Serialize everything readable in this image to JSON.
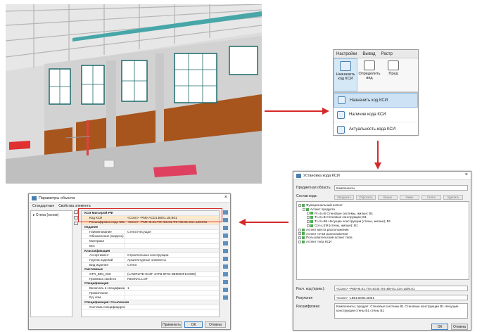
{
  "ribbon": {
    "tabs": [
      "Настройки",
      "Вывод",
      "Растр"
    ],
    "buttons": [
      {
        "label": "Назначить код КСИ",
        "icon": "ksi-assign-icon"
      },
      {
        "label": "Определить вид",
        "icon": "define-view-icon"
      },
      {
        "label": "Пред",
        "icon": "partial-icon"
      }
    ],
    "menu": [
      {
        "label": "Назначить код КСИ",
        "icon_text": "КСИ"
      },
      {
        "label": "Наличие кода КСИ",
        "icon_text": "КСИ"
      },
      {
        "label": "Актуальность кода КСИ",
        "icon_text": "КСИ"
      }
    ]
  },
  "assign_dialog": {
    "title": "Установка кода КСИ",
    "domain_label": "Предметная область:",
    "domain_value": "Компоненты",
    "code_label": "Состав кода:",
    "toolbar": [
      "Загрузить",
      "Сбросить",
      "Выше",
      "Ниже",
      "Снять",
      "Удалить"
    ],
    "tree": [
      {
        "level": 0,
        "text": "Функциональный аспект"
      },
      {
        "level": 1,
        "text": "Аспект продукта"
      },
      {
        "level": 2,
        "text": "Pr=S=B Стеновые системы, жилые; B1"
      },
      {
        "level": 2,
        "text": "Tr=S=B Стеновые конструкции; B1"
      },
      {
        "level": 2,
        "text": "Tr=S=B6 Несущие конструкции (стены, жилые); B1"
      },
      {
        "level": 2,
        "text": "Cor=LEM (стены, жилые); B1"
      },
      {
        "level": 0,
        "text": "Аспект места расположения"
      },
      {
        "level": 0,
        "text": "Аспект точки расположения"
      },
      {
        "level": 0,
        "text": "Пользовательский аспект типа"
      },
      {
        "level": 0,
        "text": "Аспект типа КСИ"
      }
    ],
    "result_code_label": "Расч. код (прим.):",
    "result_code_value": "<Conn> -PM0+B.01.Tr0=S0.B.Tr0=B6-01.Cor=LEM.01",
    "result_label": "Результат:",
    "result_value": "<Conn> -LB01.B001.B001",
    "decode_label": "Расшифровка:",
    "decode_value": "Компоненты; продукт; Стеновые системы B1 Стеновые конструкции B1 Несущие конструкции стены B1 стены B1",
    "ok_label": "ОК",
    "cancel_label": "Отмена"
  },
  "props_dialog": {
    "title": "Параметры объекта",
    "tabs": [
      "Стандартные",
      "Свойства элемента"
    ],
    "tree_item": "Стена (основ)",
    "rows": [
      {
        "type": "cat",
        "k": "КСИ Мигатрой РФ"
      },
      {
        "type": "row",
        "k": "Код КСИ",
        "v": "<Conn> -PM0-ACD1.B001.LB.B01",
        "hl": true
      },
      {
        "type": "row",
        "k": "Расшифровка кода КСИ",
        "v": "<Conn> -PM0+B.01.Tr0+B8.01.Tr0+B6.01.Cor=LEM.01",
        "hl": true
      },
      {
        "type": "cat",
        "k": "Издание"
      },
      {
        "type": "row",
        "k": "Наименование",
        "v": "Стена Несущая"
      },
      {
        "type": "row",
        "k": "Обозначение (модель)",
        "v": ""
      },
      {
        "type": "row",
        "k": "Материал",
        "v": ""
      },
      {
        "type": "row",
        "k": "Вес",
        "v": ""
      },
      {
        "type": "cat",
        "k": "Классификация"
      },
      {
        "type": "row",
        "k": "Ассортимент",
        "v": "Строительные конструкции"
      },
      {
        "type": "row",
        "k": "Группа изделий",
        "v": "Архитектурные элементы"
      },
      {
        "type": "row",
        "k": "Вид изделия",
        "v": "Стена"
      },
      {
        "type": "cat",
        "k": "Системные"
      },
      {
        "type": "row",
        "k": "STR_BIM_GID",
        "v": "(LAWRUTE-8A3F-4AFB-8F04-0B9003F1C0D8)"
      },
      {
        "type": "row",
        "k": "Привязка свойств",
        "v": "REONAL.LOT"
      },
      {
        "type": "cat",
        "k": "Спецификация"
      },
      {
        "type": "row",
        "k": "Включать в спецификацию",
        "v": "1"
      },
      {
        "type": "row",
        "k": "Примечание",
        "v": ""
      },
      {
        "type": "row",
        "k": "Ед. изм.",
        "v": ""
      },
      {
        "type": "cat",
        "k": "Спецификация: Ссылочная"
      },
      {
        "type": "row",
        "k": "Система специфицирования",
        "v": ""
      }
    ],
    "apply_label": "Применить",
    "ok_label": "ОК",
    "cancel_label": "Отмена"
  }
}
